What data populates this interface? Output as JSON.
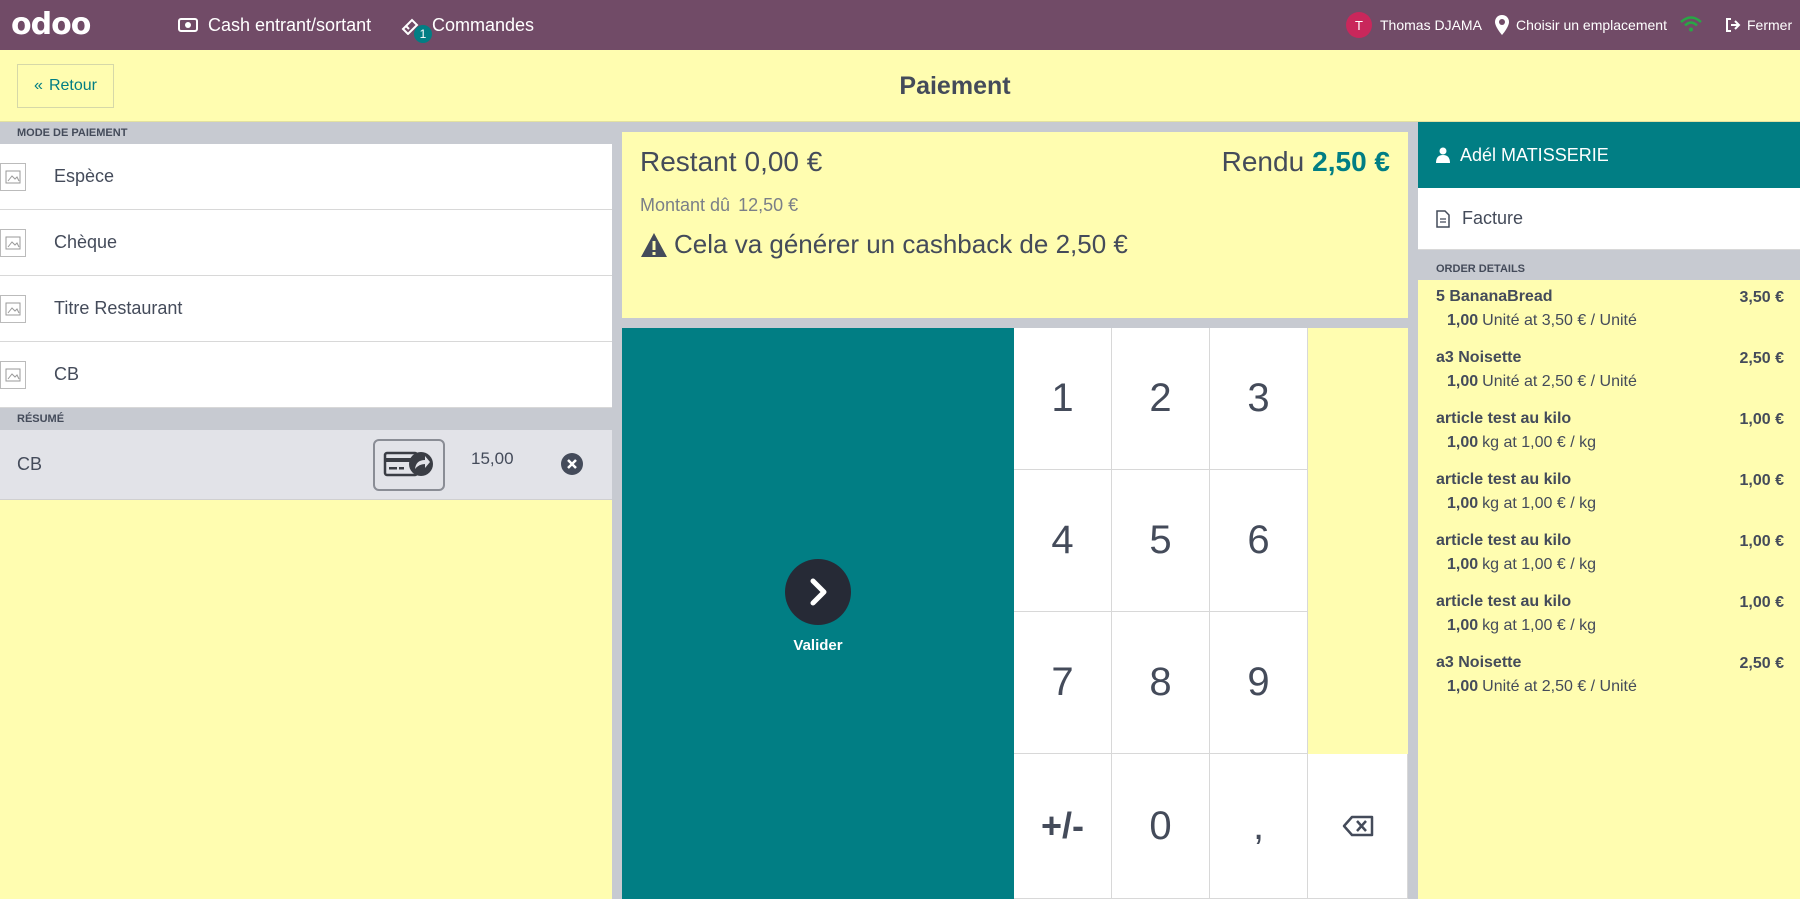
{
  "navbar": {
    "logo": "odoo",
    "cash_label": "Cash entrant/sortant",
    "orders_label": "Commandes",
    "orders_count": "1",
    "user_initial": "T",
    "user_name": "Thomas DJAMA",
    "location_label": "Choisir un emplacement",
    "close_label": "Fermer"
  },
  "header": {
    "back_label": "Retour",
    "title": "Paiement"
  },
  "payment_methods": {
    "section_label": "MODE DE PAIEMENT",
    "items": [
      {
        "label": "Espèce"
      },
      {
        "label": "Chèque"
      },
      {
        "label": "Titre Restaurant"
      },
      {
        "label": "CB"
      }
    ]
  },
  "summary": {
    "section_label": "RÉSUMÉ",
    "lines": [
      {
        "name": "CB",
        "amount": "15,00"
      }
    ]
  },
  "status": {
    "restant_label": "Restant",
    "restant_value": "0,00 €",
    "rendu_label": "Rendu",
    "rendu_value": "2,50 €",
    "du_label": "Montant dû",
    "du_value": "12,50 €",
    "cashback_text": "Cela va générer un cashback de 2,50 €"
  },
  "validate_label": "Valider",
  "numpad": {
    "keys": [
      "1",
      "2",
      "3",
      "4",
      "5",
      "6",
      "7",
      "8",
      "9",
      "+/-",
      "0",
      ","
    ]
  },
  "customer": {
    "name": "Adél MATISSERIE",
    "invoice_label": "Facture"
  },
  "order_details": {
    "section_label": "ORDER DETAILS",
    "lines": [
      {
        "name": "5 BananaBread",
        "price": "3,50 €",
        "qty": "1,00",
        "info": "Unité at 3,50 € / Unité"
      },
      {
        "name": "a3 Noisette",
        "price": "2,50 €",
        "qty": "1,00",
        "info": "Unité at 2,50 € / Unité"
      },
      {
        "name": "article test au kilo",
        "price": "1,00 €",
        "qty": "1,00",
        "info": "kg at 1,00 € / kg"
      },
      {
        "name": "article test au kilo",
        "price": "1,00 €",
        "qty": "1,00",
        "info": "kg at 1,00 € / kg"
      },
      {
        "name": "article test au kilo",
        "price": "1,00 €",
        "qty": "1,00",
        "info": "kg at 1,00 € / kg"
      },
      {
        "name": "article test au kilo",
        "price": "1,00 €",
        "qty": "1,00",
        "info": "kg at 1,00 € / kg"
      },
      {
        "name": "a3 Noisette",
        "price": "2,50 €",
        "qty": "1,00",
        "info": "Unité at 2,50 € / Unité"
      }
    ]
  },
  "colors": {
    "navbar": "#714b67",
    "accent": "#017e84",
    "highlight": "#fffdb0",
    "text": "#444b5a"
  }
}
